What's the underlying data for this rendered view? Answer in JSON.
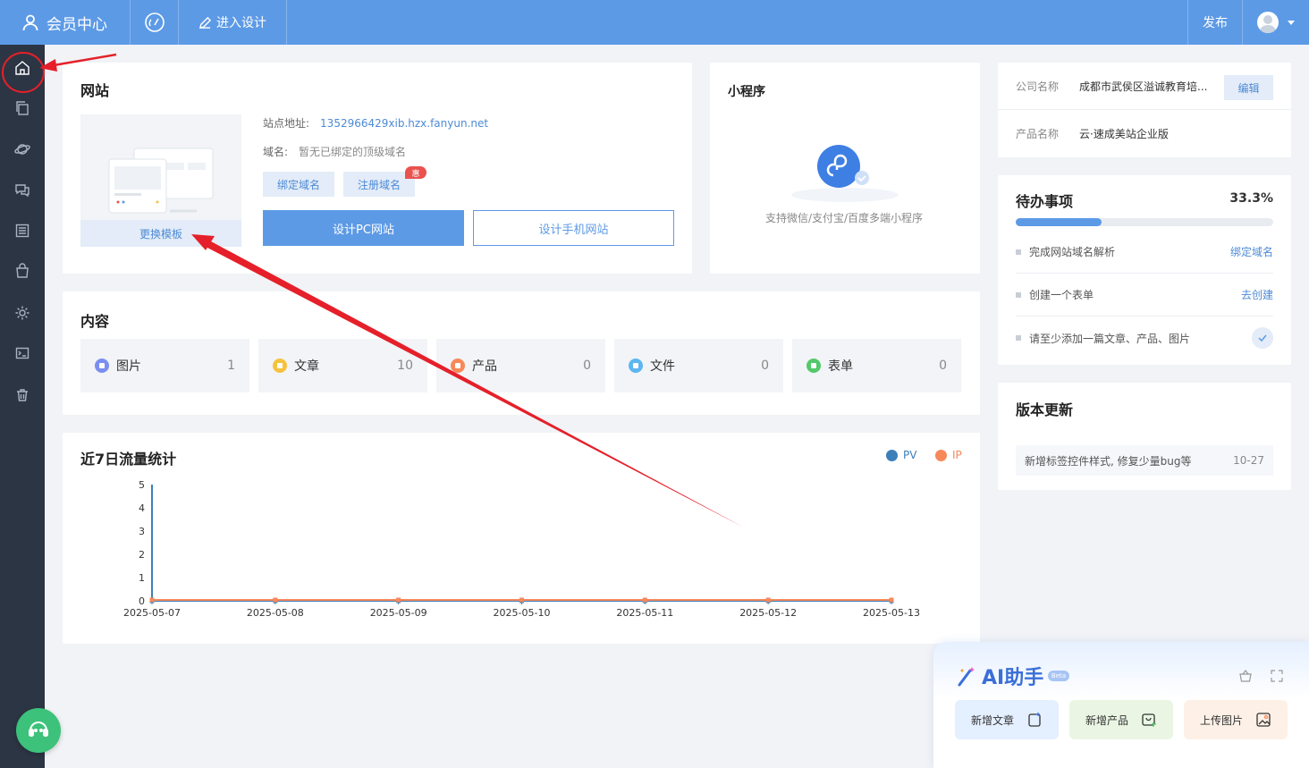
{
  "topbar": {
    "title": "会员中心",
    "design_label": "进入设计",
    "publish_label": "发布"
  },
  "website": {
    "title": "网站",
    "change_template": "更换模板",
    "site_addr_label": "站点地址:",
    "site_addr_value": "1352966429xib.hzx.fanyun.net",
    "domain_label": "域名:",
    "domain_value": "暂无已绑定的顶级域名",
    "bind_domain": "绑定域名",
    "register_domain": "注册域名",
    "promo_badge": "惠",
    "design_pc": "设计PC网站",
    "design_mobile": "设计手机网站"
  },
  "mini_program": {
    "title": "小程序",
    "description": "支持微信/支付宝/百度多端小程序"
  },
  "content": {
    "title": "内容",
    "items": [
      {
        "label": "图片",
        "count": "1",
        "color": "#7b8ff0"
      },
      {
        "label": "文章",
        "count": "10",
        "color": "#f6c23e"
      },
      {
        "label": "产品",
        "count": "0",
        "color": "#f7885a"
      },
      {
        "label": "文件",
        "count": "0",
        "color": "#5cb6f0"
      },
      {
        "label": "表单",
        "count": "0",
        "color": "#52c96a"
      }
    ]
  },
  "traffic": {
    "title": "近7日流量统计"
  },
  "chart_data": {
    "type": "line",
    "x": [
      "2025-05-07",
      "2025-05-08",
      "2025-05-09",
      "2025-05-10",
      "2025-05-11",
      "2025-05-12",
      "2025-05-13"
    ],
    "series": [
      {
        "name": "PV",
        "values": [
          0,
          0,
          0,
          0,
          0,
          0,
          0
        ],
        "color": "#3d7fb8"
      },
      {
        "name": "IP",
        "values": [
          0,
          0,
          0,
          0,
          0,
          0,
          0
        ],
        "color": "#f7885a"
      }
    ],
    "yticks": [
      0,
      1,
      2,
      3,
      4,
      5
    ],
    "ylim": [
      0,
      5
    ],
    "legend": "top-right",
    "grid": false
  },
  "company": {
    "name_label": "公司名称",
    "name_value": "成都市武侯区溢诚教育培...",
    "edit_label": "编辑",
    "product_label": "产品名称",
    "product_value": "云·速成美站企业版"
  },
  "todo": {
    "title": "待办事项",
    "percent_text": "33.3%",
    "progress": 0.333,
    "items": [
      {
        "text": "完成网站域名解析",
        "action": "绑定域名"
      },
      {
        "text": "创建一个表单",
        "action": "去创建"
      },
      {
        "text": "请至少添加一篇文章、产品、图片",
        "action": ""
      }
    ]
  },
  "updates": {
    "title": "版本更新",
    "items": [
      {
        "text": "新增标签控件样式, 修复少量bug等",
        "date": "10-27"
      }
    ]
  },
  "ai": {
    "title": "AI助手",
    "beta": "Beta",
    "buttons": [
      {
        "label": "新增文章",
        "bg": "#e4efff"
      },
      {
        "label": "新增产品",
        "bg": "#eaf6e3"
      },
      {
        "label": "上传图片",
        "bg": "#fdf0e6"
      }
    ]
  }
}
